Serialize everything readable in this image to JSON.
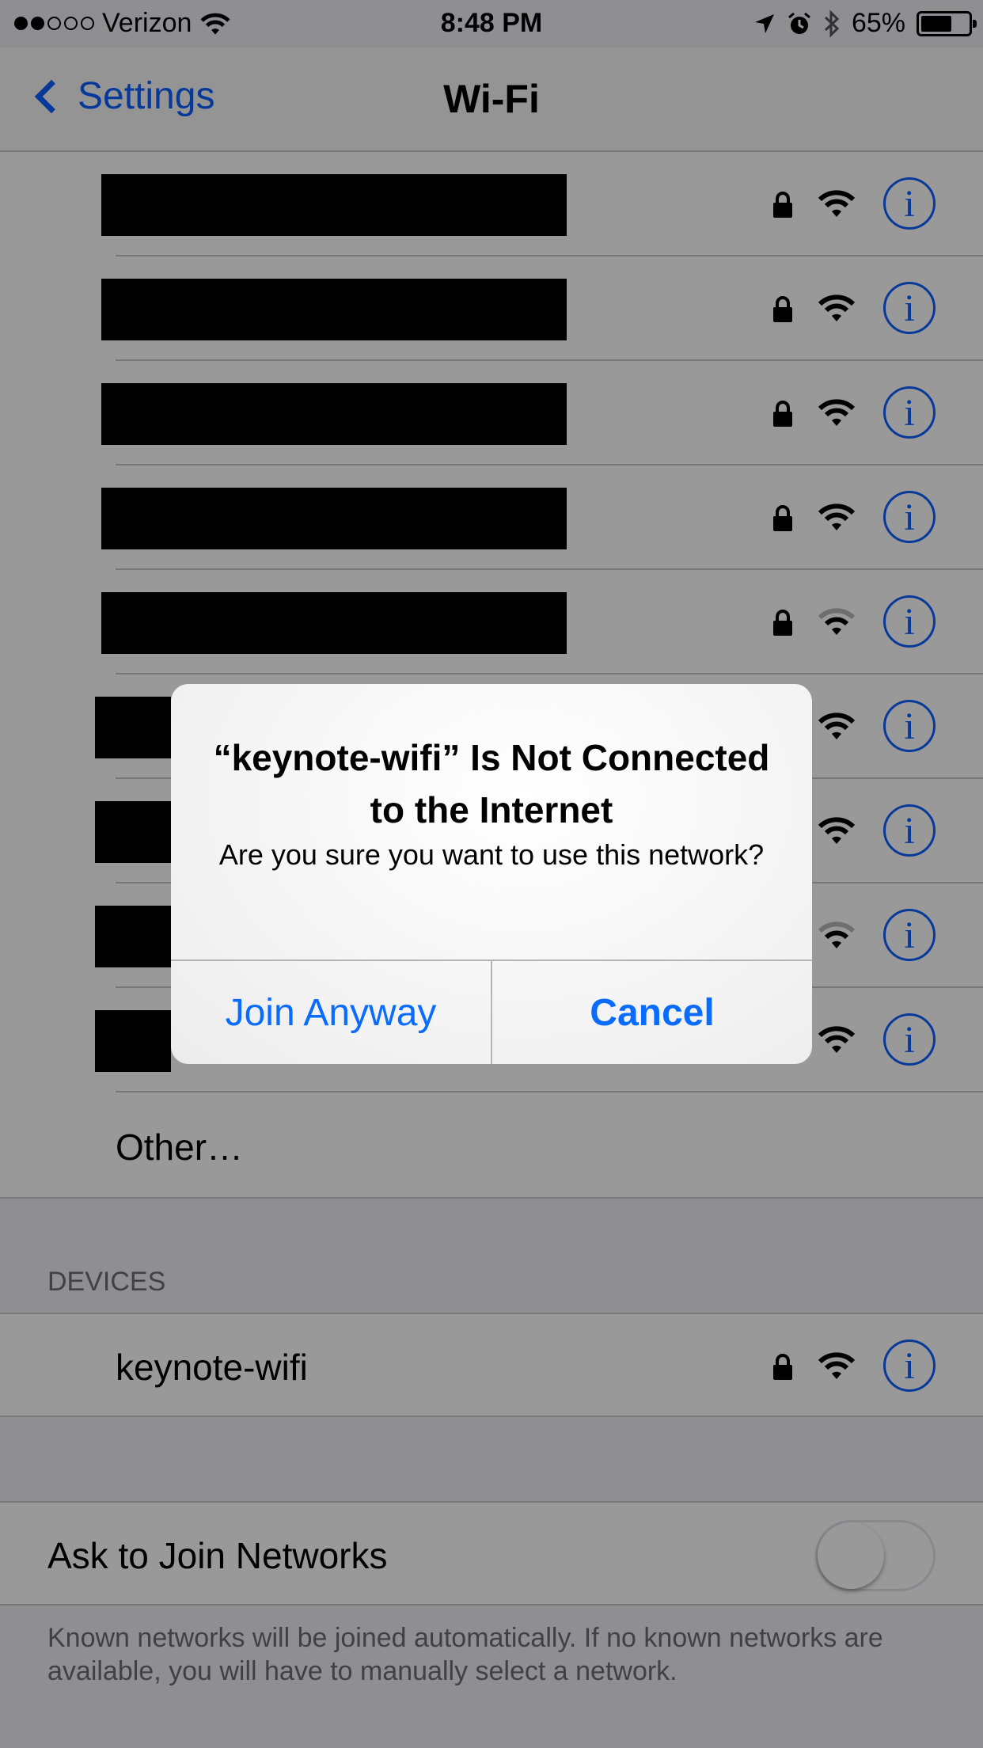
{
  "status_bar": {
    "carrier": "Verizon",
    "time": "8:48 PM",
    "battery_percent": "65%",
    "battery_level": 0.65,
    "signal_bars_filled": 2,
    "signal_bars_total": 5,
    "icons": [
      "wifi-icon",
      "location-arrow-icon",
      "alarm-icon",
      "bluetooth-icon",
      "battery-icon"
    ]
  },
  "nav": {
    "back_label": "Settings",
    "title": "Wi-Fi"
  },
  "networks": [
    {
      "name": "",
      "secured": true,
      "signal": 3,
      "redacted": true
    },
    {
      "name": "",
      "secured": true,
      "signal": 3,
      "redacted": true
    },
    {
      "name": "",
      "secured": true,
      "signal": 3,
      "redacted": true
    },
    {
      "name": "",
      "secured": true,
      "signal": 3,
      "redacted": true
    },
    {
      "name": "",
      "secured": true,
      "signal": 2,
      "redacted": true
    },
    {
      "name": "",
      "secured": false,
      "signal": 3,
      "redacted": true
    },
    {
      "name": "",
      "secured": false,
      "signal": 3,
      "redacted": true
    },
    {
      "name": "",
      "secured": false,
      "signal": 2,
      "redacted": true
    },
    {
      "name": "",
      "secured": false,
      "signal": 3,
      "redacted": true
    }
  ],
  "other_label": "Other…",
  "devices": {
    "header": "DEVICES",
    "items": [
      {
        "name": "keynote-wifi",
        "secured": true,
        "signal": 3
      }
    ]
  },
  "ask_to_join": {
    "label": "Ask to Join Networks",
    "enabled": false,
    "footer": "Known networks will be joined automatically. If no known networks are available, you will have to manually select a network."
  },
  "alert": {
    "title": "“keynote-wifi” Is Not Connected to the Internet",
    "message": "Are you sure you want to use this network?",
    "buttons": [
      "Join Anyway",
      "Cancel"
    ]
  },
  "colors": {
    "accent": "#0a60ff",
    "separator": "#c8c7cc",
    "group_background": "#efeff4"
  }
}
